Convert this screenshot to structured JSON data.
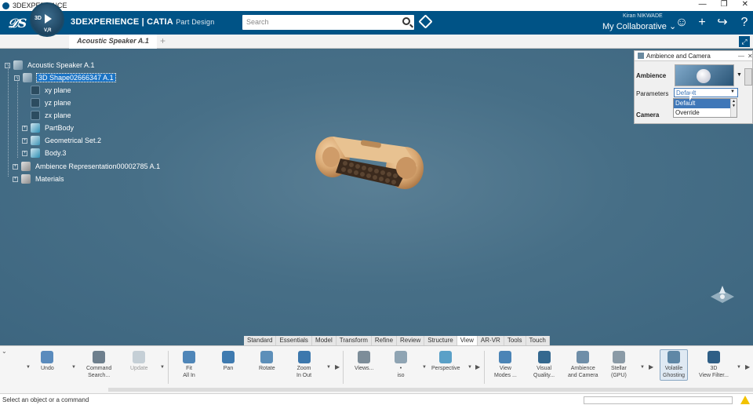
{
  "window": {
    "title": "3DEXPERIENCE",
    "controls": [
      "—",
      "❐",
      "✕"
    ]
  },
  "header": {
    "compass": {
      "label_3d": "3D",
      "label_vr": "V,R"
    },
    "brand_main": "3DEXPERIENCE | CATIA",
    "brand_sub": "Part Design",
    "search_placeholder": "Search",
    "user_name": "Kiran NIKWADE",
    "collab_space": "My Collaborative",
    "icons": [
      "tag-icon",
      "user-icon",
      "plus-icon",
      "share-icon",
      "help-icon"
    ]
  },
  "tabs": {
    "active": "Acoustic Speaker A.1",
    "add": "+"
  },
  "tree": {
    "root": "Acoustic Speaker A.1",
    "shape": "3D Shape02666347 A.1",
    "planes": [
      "xy plane",
      "yz plane",
      "zx plane"
    ],
    "partbody": "PartBody",
    "geoset": "Geometrical Set.2",
    "body3": "Body.3",
    "ambience_rep": "Ambience Representation00002785 A.1",
    "materials": "Materials"
  },
  "ambience_panel": {
    "title": "Ambience and Camera",
    "ambience_label": "Ambience",
    "parameters_label": "Parameters",
    "parameters_value": "Default",
    "camera_label": "Camera",
    "options": [
      "Default",
      "Override"
    ]
  },
  "sections": [
    "Standard",
    "Essentials",
    "Model",
    "Transform",
    "Refine",
    "Review",
    "Structure",
    "View",
    "AR-VR",
    "Tools",
    "Touch"
  ],
  "active_section": "View",
  "tools": {
    "undo": "Undo",
    "command_search": [
      "Command",
      "Search..."
    ],
    "update": "Update",
    "fit_all": [
      "Fit",
      "All In"
    ],
    "pan": "Pan",
    "rotate": "Rotate",
    "zoom": [
      "Zoom",
      "In Out"
    ],
    "views": "Views...",
    "iso_top": "•",
    "iso": "iso",
    "perspective": "Perspective",
    "view_modes": [
      "View",
      "Modes ..."
    ],
    "visual_quality": [
      "Visual",
      "Quality..."
    ],
    "ambience_camera": [
      "Ambience",
      "and Camera"
    ],
    "stellar": [
      "Stellar",
      "(GPU)"
    ],
    "volatile_ghosting": [
      "Volatile",
      "Ghosting"
    ],
    "view_filter": [
      "3D",
      "View Filter..."
    ]
  },
  "status": {
    "message": "Select an object or a command"
  },
  "colors": {
    "header": "#005386",
    "viewport": "#3f6780",
    "selection": "#1a73c4"
  }
}
